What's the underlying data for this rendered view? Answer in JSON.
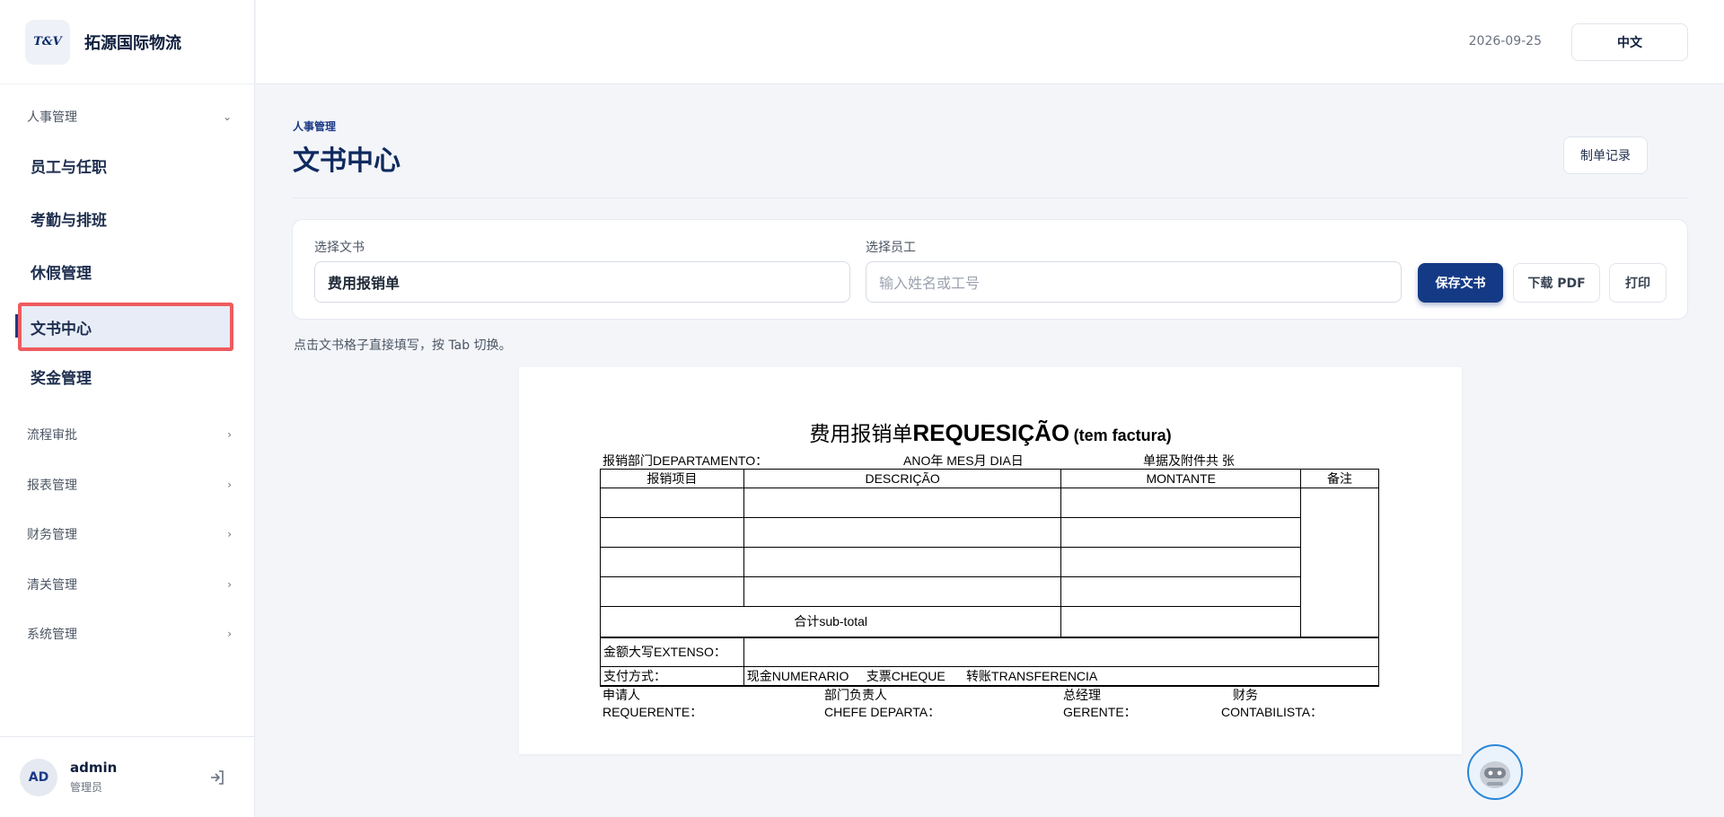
{
  "brand": {
    "logo_text": "T&V",
    "name": "拓源国际物流"
  },
  "sidebar": {
    "groups": [
      {
        "label": "人事管理",
        "expanded": true
      },
      {
        "label": "流程审批"
      },
      {
        "label": "报表管理"
      },
      {
        "label": "财务管理"
      },
      {
        "label": "清关管理"
      },
      {
        "label": "系统管理"
      }
    ],
    "items": [
      {
        "label": "员工与任职"
      },
      {
        "label": "考勤与排班"
      },
      {
        "label": "休假管理"
      },
      {
        "label": "文书中心",
        "active": true
      },
      {
        "label": "奖金管理"
      }
    ]
  },
  "user": {
    "initials": "AD",
    "name": "admin",
    "role": "管理员"
  },
  "header": {
    "date": "2026-09-25",
    "language": "中文"
  },
  "page": {
    "breadcrumb": "人事管理",
    "title": "文书中心",
    "records_button": "制单记录",
    "hint": "点击文书格子直接填写，按 Tab 切换。"
  },
  "form": {
    "doc_label": "选择文书",
    "doc_value": "费用报销单",
    "employee_label": "选择员工",
    "employee_placeholder": "输入姓名或工号",
    "save_button": "保存文书",
    "pdf_button": "下载 PDF",
    "print_button": "打印"
  },
  "document": {
    "title_zh": "费用报销单",
    "title_pt": "REQUESIÇÃO",
    "title_suffix": "(tem factura)",
    "dept_label": "报销部门DEPARTAMENTO：",
    "date_label": "ANO年   MES月   DIA日",
    "attach_label": "单据及附件共  张",
    "col_item": "报销项目",
    "col_desc": "DESCRIÇÃO",
    "col_amount": "MONTANTE",
    "col_note": "备注",
    "subtotal": "合计sub-total",
    "extenso": "金额大写EXTENSO：",
    "payment_label": "支付方式：",
    "payment_options": "现金NUMERARIO     支票CHEQUE      转账TRANSFERENCIA",
    "sig_req_zh": "申请人",
    "sig_req": "REQUERENTE：",
    "sig_chef_zh": "部门负责人",
    "sig_chef": "CHEFE DEPARTA：",
    "sig_ger_zh": "总经理",
    "sig_ger": "GERENTE：",
    "sig_con_zh": "财务",
    "sig_con": "CONTABILISTA："
  },
  "colors": {
    "primary": "#153a85",
    "highlight": "#ee5b5f",
    "active_bg": "#e7ecf7"
  }
}
